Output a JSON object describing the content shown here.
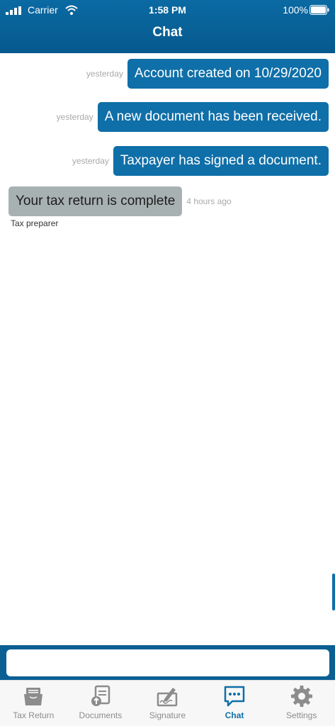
{
  "status_bar": {
    "carrier": "Carrier",
    "time": "1:58 PM",
    "battery": "100%"
  },
  "nav": {
    "title": "Chat"
  },
  "messages": [
    {
      "direction": "out",
      "text": "Account created on 10/29/2020",
      "timestamp": "yesterday"
    },
    {
      "direction": "out",
      "text": "A new document has been received.",
      "timestamp": "yesterday"
    },
    {
      "direction": "out",
      "text": "Taxpayer has signed a document.",
      "timestamp": "yesterday"
    },
    {
      "direction": "in",
      "text": "Your tax return is complete",
      "timestamp": "4 hours ago",
      "sender": "Tax preparer"
    }
  ],
  "input": {
    "value": "",
    "placeholder": ""
  },
  "tabs": [
    {
      "label": "Tax Return",
      "icon": "folder-icon",
      "active": false
    },
    {
      "label": "Documents",
      "icon": "document-upload-icon",
      "active": false
    },
    {
      "label": "Signature",
      "icon": "signature-icon",
      "active": false
    },
    {
      "label": "Chat",
      "icon": "chat-bubble-icon",
      "active": true
    },
    {
      "label": "Settings",
      "icon": "gear-icon",
      "active": false
    }
  ],
  "colors": {
    "brand": "#0f6fa8",
    "incoming_bubble": "#a8b1b1",
    "tab_inactive": "#8c8c8c"
  }
}
